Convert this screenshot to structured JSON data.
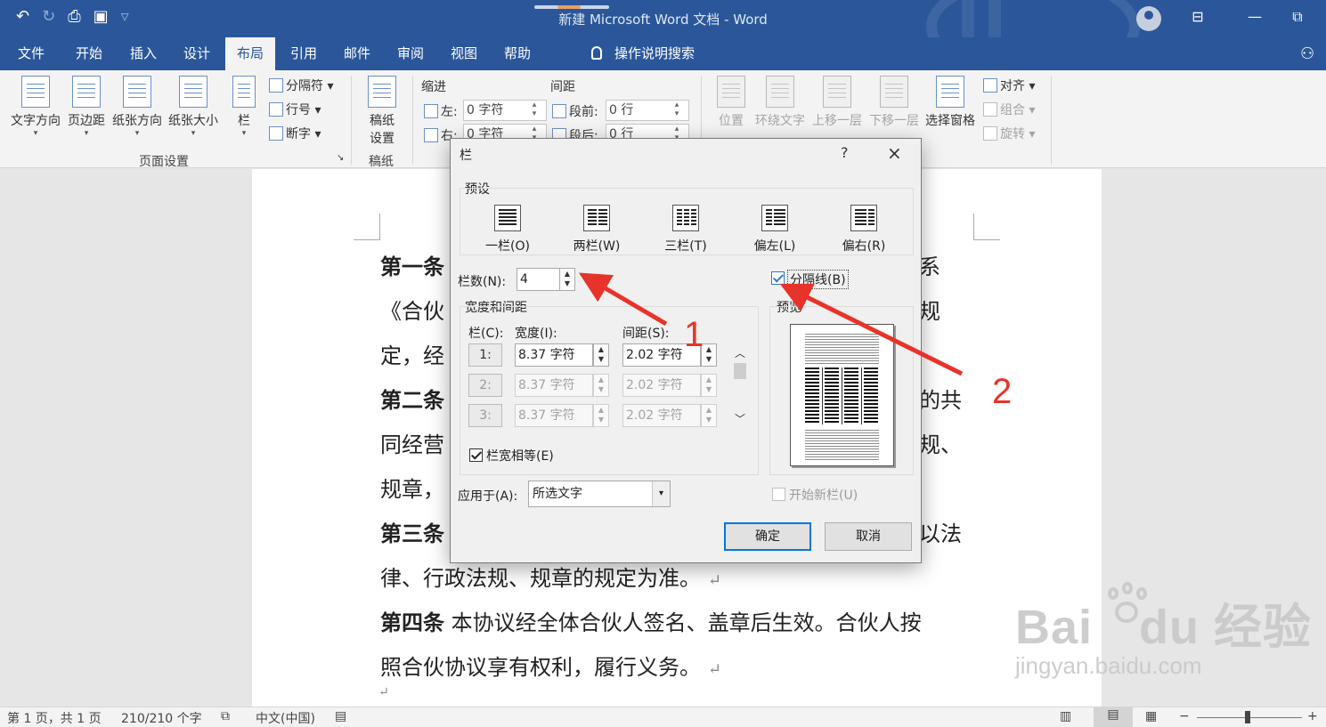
{
  "window": {
    "title": "新建 Microsoft Word 文档 - Word"
  },
  "tabs": [
    "文件",
    "开始",
    "插入",
    "设计",
    "布局",
    "引用",
    "邮件",
    "审阅",
    "视图",
    "帮助"
  ],
  "active_tab": "布局",
  "tell_me": "操作说明搜索",
  "ribbon": {
    "page_setup": {
      "text_direction": "文字方向",
      "margins": "页边距",
      "orientation": "纸张方向",
      "size": "纸张大小",
      "columns": "栏",
      "breaks": "分隔符",
      "line_numbers": "行号",
      "hyphenation": "断字",
      "group_label": "页面设置"
    },
    "manuscript": {
      "label": "稿纸设置",
      "label_line1": "稿纸",
      "label_line2": "设置",
      "group_label": "稿纸"
    },
    "paragraph": {
      "indent_label": "缩进",
      "spacing_label": "间距",
      "left_label": "左:",
      "left_value": "0 字符",
      "right_label": "右:",
      "right_value": "0 字符",
      "before_label": "段前:",
      "before_value": "0 行",
      "after_label": "段后:",
      "after_value": "0 行"
    },
    "arrange": {
      "position": "位置",
      "wrap_text": "环绕文字",
      "bring_forward": "上移一层",
      "send_backward": "下移一层",
      "selection_pane": "选择窗格",
      "align": "对齐",
      "group": "组合",
      "rotate": "旋转"
    }
  },
  "document": {
    "lines": [
      {
        "bold": "第一条",
        "text": "",
        "tail": "系"
      },
      {
        "bold": "",
        "text": "《合伙",
        "tail": "规"
      },
      {
        "bold": "",
        "text": "定，经",
        "tail": ""
      },
      {
        "bold": "第二条",
        "text": "",
        "tail": "的共"
      },
      {
        "bold": "",
        "text": "同经营",
        "tail": "规、"
      },
      {
        "bold": "",
        "text": "规章，",
        "tail": ""
      },
      {
        "bold": "第三条",
        "text": "",
        "tail": "以法"
      },
      {
        "bold": "",
        "text": "律、行政法规、规章的规定为准。",
        "tail": ""
      },
      {
        "bold": "第四条",
        "text": " 本协议经全体合伙人签名、盖章后生效。合伙人按",
        "tail": ""
      },
      {
        "bold": "",
        "text": "照合伙协议享有权利，履行义务。",
        "tail": ""
      }
    ],
    "para_mark": "↵"
  },
  "statusbar": {
    "page": "第 1 页，共 1 页",
    "words": "210/210 个字",
    "language": "中文(中国)",
    "zoom_out": "−",
    "zoom_in": "+"
  },
  "dialog": {
    "title": "栏",
    "help": "?",
    "close": "×",
    "presets_label": "预设",
    "presets": [
      "一栏(O)",
      "两栏(W)",
      "三栏(T)",
      "偏左(L)",
      "偏右(R)"
    ],
    "num_columns_label": "栏数(N):",
    "num_columns_value": "4",
    "line_between_label": "分隔线(B)",
    "line_between_checked": true,
    "width_spacing_label": "宽度和间距",
    "col_header": "栏(C):",
    "width_header": "宽度(I):",
    "spacing_header": "间距(S):",
    "rows": [
      {
        "col": "1:",
        "width": "8.37 字符",
        "spacing": "2.02 字符",
        "enabled": true
      },
      {
        "col": "2:",
        "width": "8.37 字符",
        "spacing": "2.02 字符",
        "enabled": false
      },
      {
        "col": "3:",
        "width": "8.37 字符",
        "spacing": "2.02 字符",
        "enabled": false
      }
    ],
    "equal_width_label": "栏宽相等(E)",
    "equal_width_checked": true,
    "apply_to_label": "应用于(A):",
    "apply_to_value": "所选文字",
    "preview_label": "预览",
    "start_new_column_label": "开始新栏(U)",
    "ok": "确定",
    "cancel": "取消"
  },
  "annotations": {
    "marker_1": "1",
    "marker_2": "2",
    "color": "#e8332a"
  },
  "watermark": {
    "logo": "Bai du 经验",
    "logo_part1": "Bai",
    "logo_part2": "du",
    "logo_part3": "经验",
    "url": "jingyan.baidu.com"
  },
  "colors": {
    "title_bar": "#2b579a",
    "ribbon": "#f3f3f3",
    "accent": "#0078d7"
  }
}
